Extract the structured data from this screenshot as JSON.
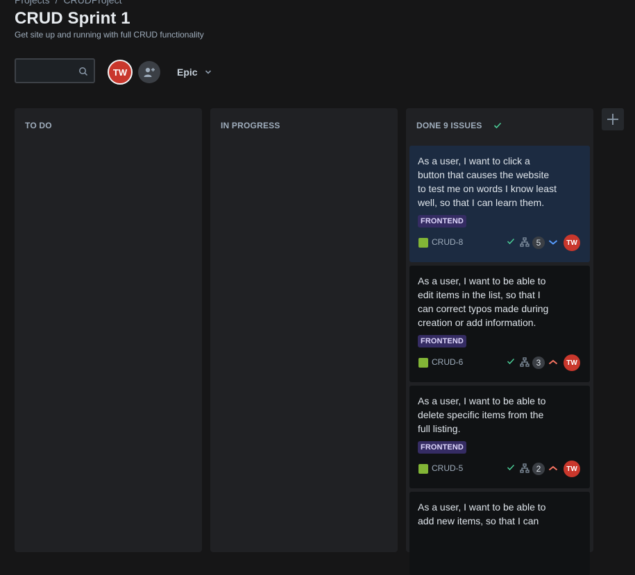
{
  "breadcrumb": {
    "items": [
      "Projects",
      "CRUDProject"
    ],
    "separator": "/"
  },
  "page": {
    "title": "CRUD Sprint 1",
    "subtitle": "Get site up and running with full CRUD functionality"
  },
  "toolbar": {
    "search_placeholder": "",
    "avatar_initials": "TW",
    "epic_label": "Epic"
  },
  "columns": [
    {
      "title": "TO DO"
    },
    {
      "title": "IN PROGRESS"
    },
    {
      "title": "DONE 9 ISSUES"
    }
  ],
  "cards": [
    {
      "title": "As a user, I want to click a button that causes the website to test me on words I know least well, so that I can learn them.",
      "label": "FRONTEND",
      "key": "CRUD-8",
      "points": "5",
      "priority": "low",
      "assignee": "TW"
    },
    {
      "title": "As a user, I want to be able to edit items in the list, so that I can correct typos made during creation or add information.",
      "label": "FRONTEND",
      "key": "CRUD-6",
      "points": "3",
      "priority": "medium",
      "assignee": "TW"
    },
    {
      "title": "As a user, I want to be able to delete specific items from the full listing.",
      "label": "FRONTEND",
      "key": "CRUD-5",
      "points": "2",
      "priority": "medium",
      "assignee": "TW"
    },
    {
      "title": "As a user, I want to be able to add new items, so that I can"
    }
  ],
  "colors": {
    "background": "#161617",
    "column": "#202124",
    "card": "#101214",
    "card_selected": "#1c2b41",
    "label_bg": "#352c63",
    "avatar": "#c9372c",
    "story": "#82b536",
    "done_check": "#4bce97",
    "priority_low": "#579dff",
    "priority_medium": "#f87462"
  },
  "icons": [
    "search-icon",
    "add-person-icon",
    "chevron-down-icon",
    "check-icon",
    "plus-icon",
    "story-icon",
    "subtask-tree-icon",
    "priority-low-icon",
    "priority-medium-icon"
  ]
}
